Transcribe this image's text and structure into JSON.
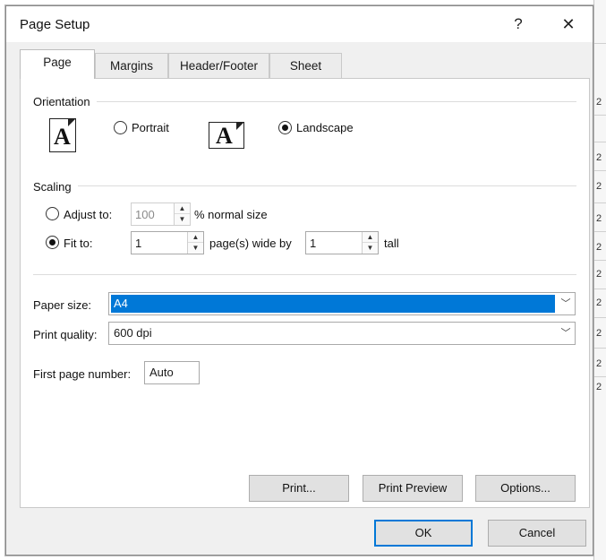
{
  "dialog": {
    "title": "Page Setup",
    "help_label": "?",
    "close_label": "✕"
  },
  "tabs": [
    {
      "label": "Page",
      "active": true
    },
    {
      "label": "Margins",
      "active": false
    },
    {
      "label": "Header/Footer",
      "active": false
    },
    {
      "label": "Sheet",
      "active": false
    }
  ],
  "orientation": {
    "label": "Orientation",
    "portrait_icon_letter": "A",
    "landscape_icon_letter": "A",
    "portrait_label": "Portrait",
    "landscape_label": "Landscape",
    "selected": "landscape"
  },
  "scaling": {
    "label": "Scaling",
    "adjust_to_label": "Adjust to:",
    "adjust_to_value": "100",
    "adjust_to_suffix": "% normal size",
    "fit_to_label": "Fit to:",
    "fit_wide_value": "1",
    "fit_wide_suffix": "page(s) wide by",
    "fit_tall_value": "1",
    "fit_tall_suffix": "tall",
    "selected": "fit_to"
  },
  "paper_size": {
    "label": "Paper size:",
    "value": "A4"
  },
  "print_quality": {
    "label": "Print quality:",
    "value": "600 dpi"
  },
  "first_page_number": {
    "label": "First page number:",
    "value": "Auto"
  },
  "buttons": {
    "print": "Print...",
    "print_preview": "Print Preview",
    "options": "Options...",
    "ok": "OK",
    "cancel": "Cancel"
  },
  "background": {
    "row_digits": [
      "2",
      "2",
      "2",
      "2",
      "2",
      "2",
      "2",
      "2",
      "2",
      "2"
    ]
  }
}
